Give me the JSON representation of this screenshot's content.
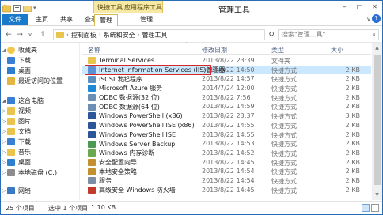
{
  "window": {
    "title": "管理工具",
    "context_group_labels": [
      "快捷工具",
      "应用程序工具"
    ],
    "controls": [
      "–",
      "□",
      "✕"
    ]
  },
  "ribbon": {
    "tabs": [
      "文件",
      "主页",
      "共享",
      "查看",
      "管理",
      "管理"
    ],
    "collapse": "∨",
    "help": "?"
  },
  "address": {
    "back": "←",
    "forward": "→",
    "up": "↑",
    "recent": "∨",
    "path": [
      "控制面板",
      "系统和安全",
      "管理工具"
    ],
    "refresh": "↻",
    "search_placeholder": "搜索\"管理工具\"",
    "search_icon": "⌕"
  },
  "sidebar": {
    "items": [
      {
        "label": "收藏夹",
        "icon": "star-icon",
        "color": "#f2c74a"
      },
      {
        "label": "下载",
        "icon": "download-folder-icon",
        "color": "#3a7fd6"
      },
      {
        "label": "桌面",
        "icon": "desktop-icon",
        "color": "#2e7fd0"
      },
      {
        "label": "最近访问的位置",
        "icon": "recent-icon",
        "color": "#e3b640"
      },
      {
        "label": "这台电脑",
        "icon": "computer-icon",
        "color": "#3a7fd6"
      },
      {
        "label": "视频",
        "icon": "video-folder-icon",
        "color": "#e9c54e"
      },
      {
        "label": "图片",
        "icon": "pictures-folder-icon",
        "color": "#e9c54e"
      },
      {
        "label": "文档",
        "icon": "documents-folder-icon",
        "color": "#e9c54e"
      },
      {
        "label": "下载",
        "icon": "download-folder-icon",
        "color": "#3a7fd6"
      },
      {
        "label": "音乐",
        "icon": "music-folder-icon",
        "color": "#e9c54e"
      },
      {
        "label": "桌面",
        "icon": "desktop-icon",
        "color": "#2e7fd0"
      },
      {
        "label": "本地磁盘 (C:)",
        "icon": "drive-icon",
        "color": "#8c8c8c"
      },
      {
        "label": "网络",
        "icon": "network-icon",
        "color": "#3b79c4"
      }
    ]
  },
  "list": {
    "headers": {
      "name": "名称",
      "date": "修改日期",
      "type": "类型",
      "size": "大小"
    },
    "files": [
      {
        "name": "Terminal Services",
        "date": "2013/8/22 23:39",
        "type": "文件夹",
        "size": "",
        "icon": "folder-icon",
        "color": "#e9c54e"
      },
      {
        "name": "Internet Information Services (IIS)管理器",
        "date": "2013/8/22 14:50",
        "type": "快捷方式",
        "size": "2 KB",
        "icon": "iis-manager-icon",
        "color": "#5b8fd6"
      },
      {
        "name": "iSCSI 发起程序",
        "date": "2013/8/22 14:57",
        "type": "快捷方式",
        "size": "2 KB",
        "icon": "iscsi-icon",
        "color": "#5a8fc0"
      },
      {
        "name": "Microsoft Azure 服务",
        "date": "2014/7/24 12:00",
        "type": "快捷方式",
        "size": "2 KB",
        "icon": "azure-icon",
        "color": "#1e88d9"
      },
      {
        "name": "ODBC 数据源(32 位)",
        "date": "2013/8/22 7:56",
        "type": "快捷方式",
        "size": "2 KB",
        "icon": "odbc-icon",
        "color": "#6b8fb5"
      },
      {
        "name": "ODBC 数据源(64 位)",
        "date": "2013/8/22 14:59",
        "type": "快捷方式",
        "size": "2 KB",
        "icon": "odbc-icon",
        "color": "#6b8fb5"
      },
      {
        "name": "Windows PowerShell (x86)",
        "date": "2013/8/22 23:37",
        "type": "快捷方式",
        "size": "3 KB",
        "icon": "powershell-icon",
        "color": "#2b579a"
      },
      {
        "name": "Windows PowerShell ISE (x86)",
        "date": "2013/8/22 14:55",
        "type": "快捷方式",
        "size": "2 KB",
        "icon": "powershell-ise-icon",
        "color": "#2b579a"
      },
      {
        "name": "Windows PowerShell ISE",
        "date": "2013/8/22 14:55",
        "type": "快捷方式",
        "size": "2 KB",
        "icon": "powershell-ise-icon",
        "color": "#2b579a"
      },
      {
        "name": "Windows Server Backup",
        "date": "2013/8/22 14:53",
        "type": "快捷方式",
        "size": "2 KB",
        "icon": "backup-icon",
        "color": "#4c9a52"
      },
      {
        "name": "Windows 内存诊断",
        "date": "2013/8/22 14:52",
        "type": "快捷方式",
        "size": "2 KB",
        "icon": "memory-diagnostic-icon",
        "color": "#6aa84f"
      },
      {
        "name": "安全配置向导",
        "date": "2013/8/22 14:45",
        "type": "快捷方式",
        "size": "2 KB",
        "icon": "security-wizard-icon",
        "color": "#c4902f"
      },
      {
        "name": "本地安全策略",
        "date": "2013/8/22 14:54",
        "type": "快捷方式",
        "size": "2 KB",
        "icon": "security-policy-icon",
        "color": "#c4902f"
      },
      {
        "name": "服务",
        "date": "2013/8/22 14:54",
        "type": "快捷方式",
        "size": "2 KB",
        "icon": "services-icon",
        "color": "#7c8ea6"
      },
      {
        "name": "高级安全 Windows 防火墙",
        "date": "2013/8/22 14:45",
        "type": "快捷方式",
        "size": "2 KB",
        "icon": "firewall-icon",
        "color": "#c0392b"
      }
    ]
  },
  "status": {
    "count": "25 个项目",
    "selected": "选中 1 个项目",
    "size": "1.10 KB"
  },
  "colors": {
    "accent": "#1979ca",
    "context": "#f6e9a3",
    "highlight": "#d62828",
    "selected_row": "#cce8ff"
  }
}
